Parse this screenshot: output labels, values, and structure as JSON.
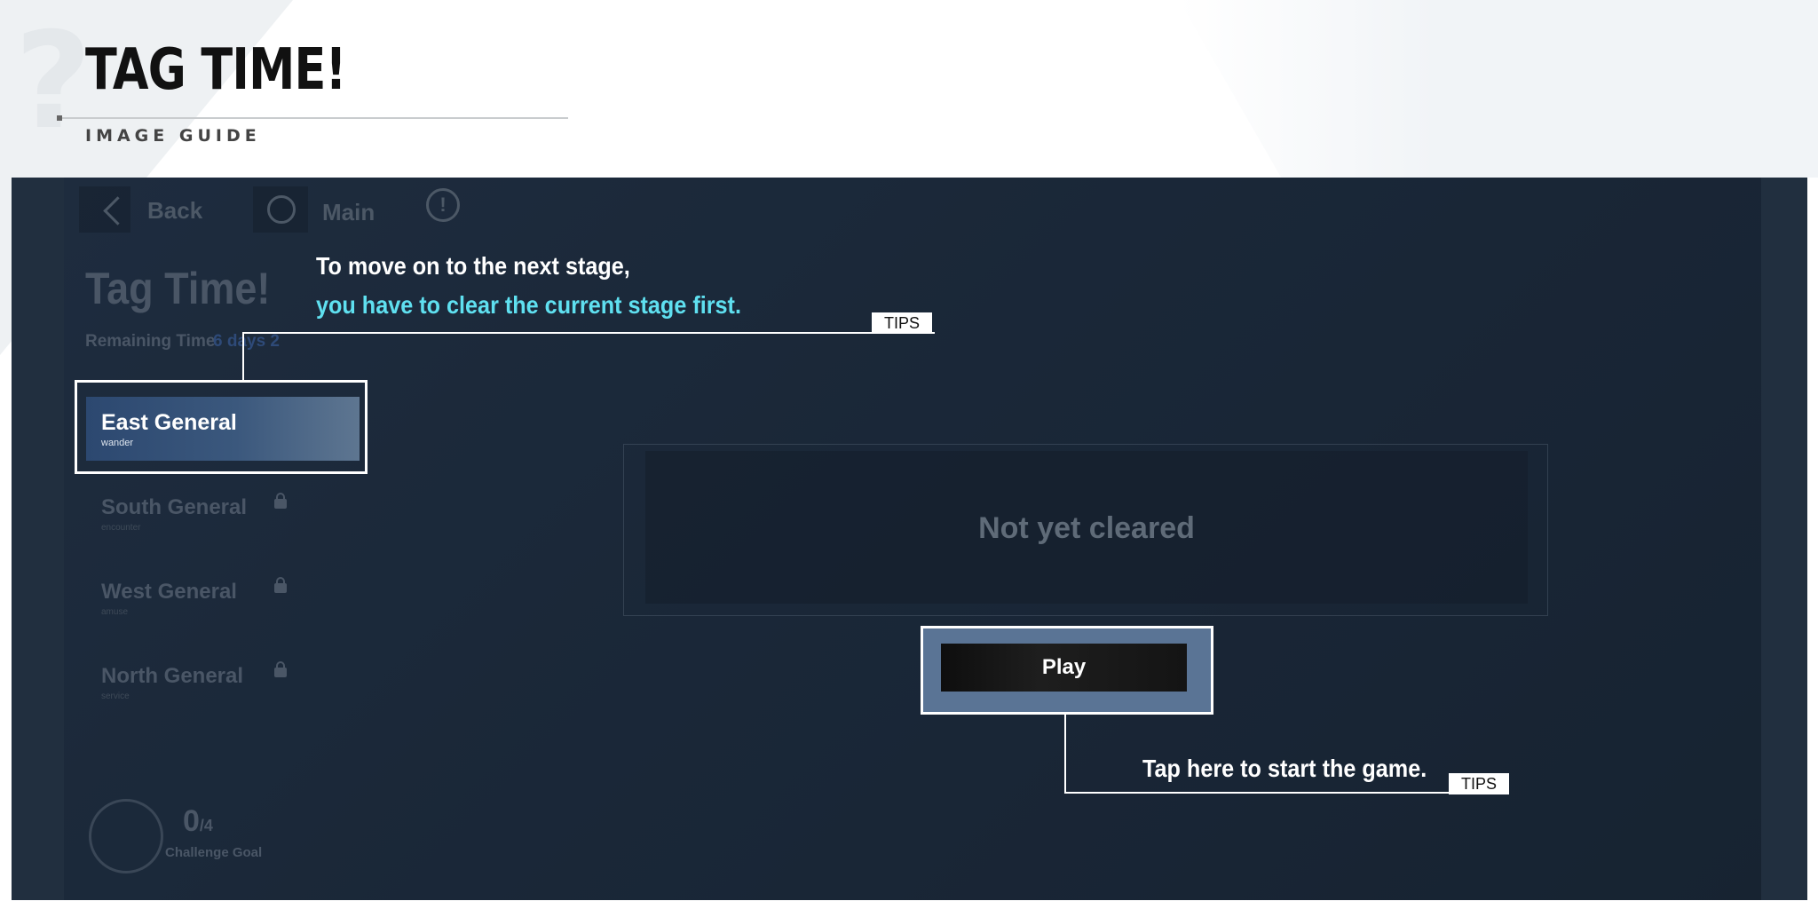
{
  "header": {
    "title": "TAG TIME!",
    "subtitle": "IMAGE GUIDE"
  },
  "game": {
    "topbar": {
      "back_label": "Back",
      "main_label": "Main",
      "info_icon": "!"
    },
    "title": "Tag Time!",
    "remaining_label": "Remaining Time",
    "remaining_value": "6 days 2",
    "stages": [
      {
        "name": "East General",
        "sub": "wander",
        "locked": false,
        "active": true
      },
      {
        "name": "South General",
        "sub": "encounter",
        "locked": true
      },
      {
        "name": "West General",
        "sub": "amuse",
        "locked": true
      },
      {
        "name": "North General",
        "sub": "service",
        "locked": true
      }
    ],
    "status_text": "Not yet cleared",
    "play_label": "Play",
    "goal": {
      "count": "0",
      "total": "/4",
      "label": "Challenge Goal"
    }
  },
  "tips": {
    "badge": "TIPS",
    "stage_tip_line1": "To move on to the next stage,",
    "stage_tip_line2": "you have to clear the current stage first.",
    "play_tip": "Tap here to start the game."
  },
  "colors": {
    "tip_accent": "#5fe0f0",
    "screen_bg": "#2a3b51",
    "highlight": "#ffffff"
  }
}
